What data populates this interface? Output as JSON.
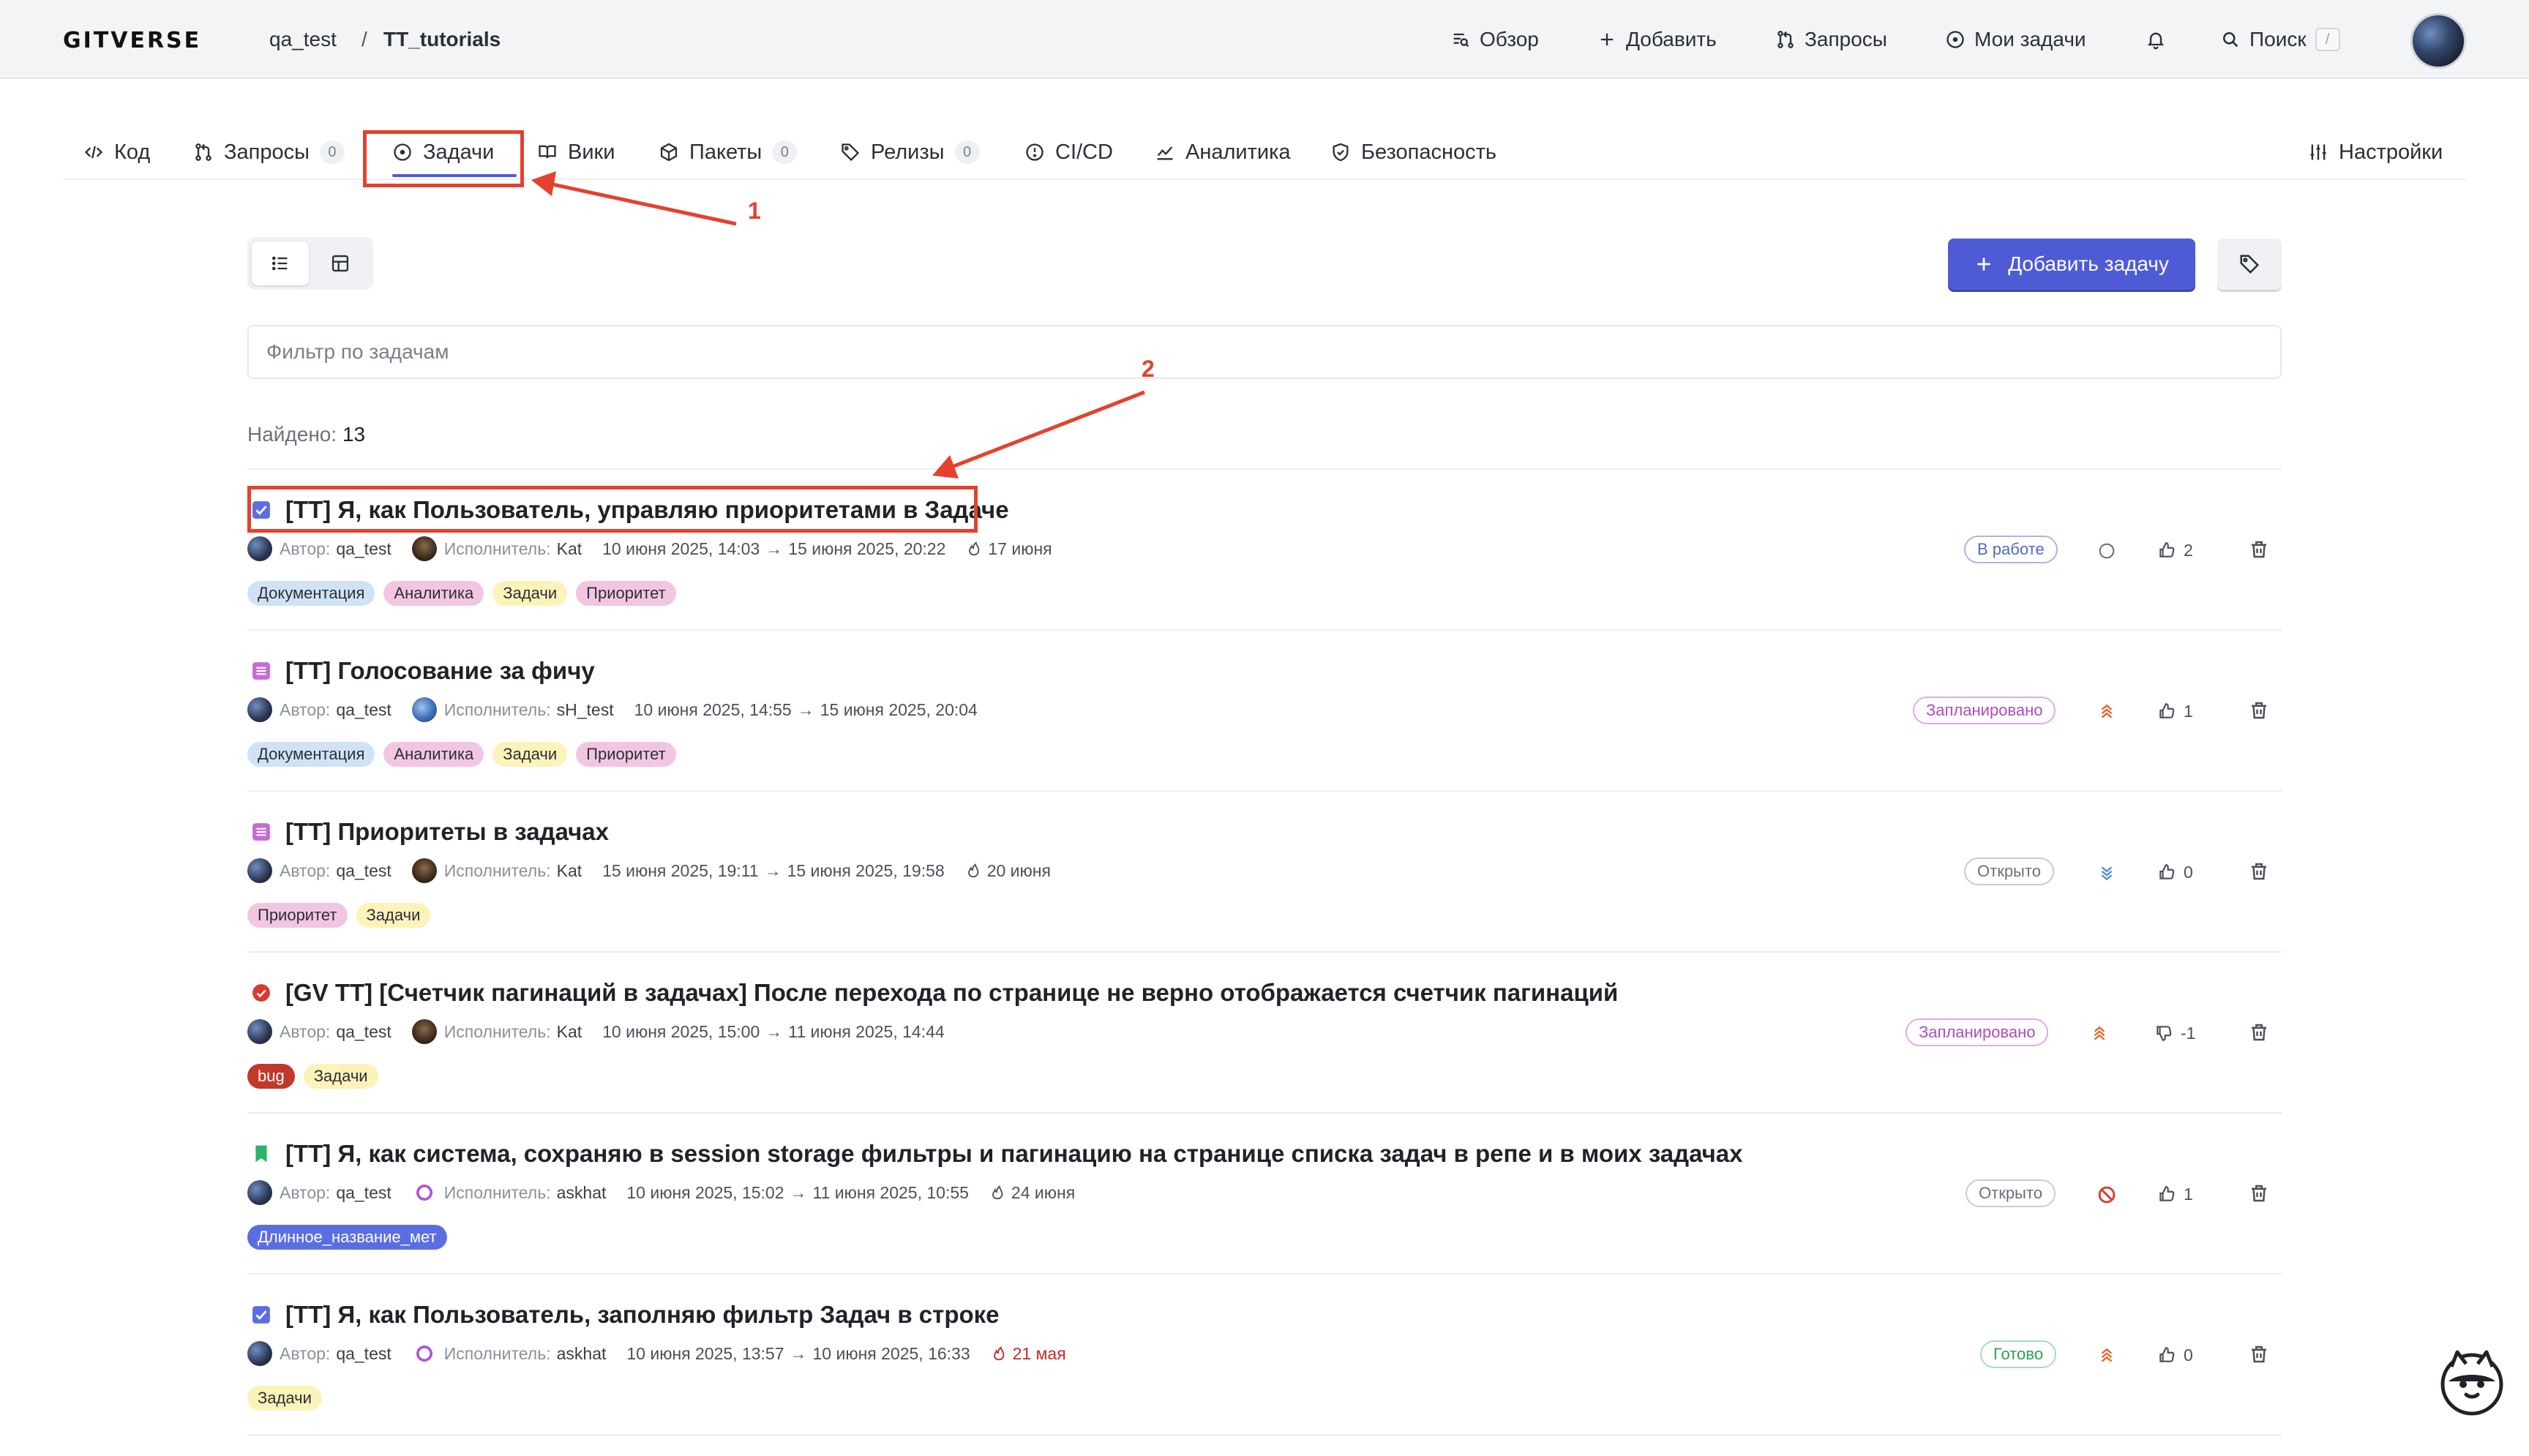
{
  "header": {
    "logo": "GITVERSE",
    "breadcrumb_owner": "qa_test",
    "breadcrumb_sep": "/",
    "breadcrumb_repo": "TT_tutorials",
    "nav": {
      "overview": "Обзор",
      "add": "Добавить",
      "requests": "Запросы",
      "my_tasks": "Мои задачи",
      "search": "Поиск",
      "search_shortcut": "/"
    }
  },
  "tabs": {
    "code": "Код",
    "requests": "Запросы",
    "requests_count": "0",
    "issues": "Задачи",
    "wiki": "Вики",
    "packages": "Пакеты",
    "packages_count": "0",
    "releases": "Релизы",
    "releases_count": "0",
    "cicd": "CI/CD",
    "analytics": "Аналитика",
    "security": "Безопасность",
    "settings": "Настройки"
  },
  "annotations": {
    "one": "1",
    "two": "2"
  },
  "toolbar": {
    "add_issue": "Добавить задачу",
    "filter_placeholder": "Фильтр по задачам",
    "found_label": "Найдено:",
    "found_count": "13"
  },
  "meta_labels": {
    "author": "Автор:",
    "assignee": "Исполнитель:"
  },
  "colors": {
    "accent": "#4f5bd5",
    "annotation": "#e5412d",
    "label_docs": "#cfe3f5",
    "label_analytics": "#f2c6e2",
    "label_tasks": "#fbf3b9",
    "label_priority": "#f2c6e2",
    "label_bug": "#c0392b",
    "label_long": "#5b6ee1"
  },
  "issues": [
    {
      "type_icon": "checkbox-icon",
      "title": "[TT] Я, как Пользователь, управляю приоритетами в Задаче",
      "author": "qa_test",
      "assignee": "Kat",
      "start": "10 июня 2025, 14:03",
      "end": "15 июня 2025, 20:22",
      "due": "17 июня",
      "labels": [
        "Документация",
        "Аналитика",
        "Задачи",
        "Приоритет"
      ],
      "status": "В работе",
      "priority_icon": "empty-circle-icon",
      "votes": "2"
    },
    {
      "type_icon": "story-icon",
      "title": "[TT] Голосование за фичу",
      "author": "qa_test",
      "assignee": "sH_test",
      "start": "10 июня 2025, 14:55",
      "end": "15 июня 2025, 20:04",
      "labels": [
        "Документация",
        "Аналитика",
        "Задачи",
        "Приоритет"
      ],
      "status": "Запланировано",
      "priority_icon": "triple-chevron-up-icon",
      "votes": "1"
    },
    {
      "type_icon": "story-icon",
      "title": "[TT] Приоритеты в задачах",
      "author": "qa_test",
      "assignee": "Kat",
      "start": "15 июня 2025, 19:11",
      "end": "15 июня 2025, 19:58",
      "due": "20 июня",
      "labels": [
        "Приоритет",
        "Задачи"
      ],
      "status": "Открыто",
      "priority_icon": "triple-chevron-down-icon",
      "votes": "0"
    },
    {
      "type_icon": "bug-icon",
      "title": "[GV TT] [Счетчик пагинаций в задачах] После перехода по странице не верно отображается счетчик пагинаций",
      "author": "qa_test",
      "assignee": "Kat",
      "start": "10 июня 2025, 15:00",
      "end": "11 июня 2025, 14:44",
      "labels": [
        "bug",
        "Задачи"
      ],
      "status": "Запланировано",
      "priority_icon": "triple-chevron-up-icon",
      "votes": "-1"
    },
    {
      "type_icon": "bookmark-icon",
      "title": "[TT] Я, как система, сохраняю в session storage фильтры и пагинацию на странице списка задач в репе и в моих задачах",
      "author": "qa_test",
      "assignee": "askhat",
      "start": "10 июня 2025, 15:02",
      "end": "11 июня 2025, 10:55",
      "due": "24 июня",
      "labels": [
        "Длинное_название_мет"
      ],
      "status": "Открыто",
      "priority_icon": "blocked-icon",
      "votes": "1"
    },
    {
      "type_icon": "checkbox-icon",
      "title": "[TT] Я, как Пользователь, заполняю фильтр Задач в строке",
      "author": "qa_test",
      "assignee": "askhat",
      "start": "10 июня 2025, 13:57",
      "end": "10 июня 2025, 16:33",
      "due": "21 мая",
      "labels": [
        "Задачи"
      ],
      "status": "Готово",
      "priority_icon": "triple-chevron-up-icon",
      "votes": "0"
    }
  ]
}
